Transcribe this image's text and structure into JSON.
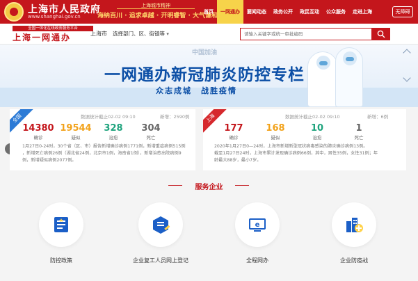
{
  "header": {
    "title": "上海市人民政府",
    "url": "www.shanghai.gov.cn",
    "slogan_top": "上海城市精神",
    "slogan": "海纳百川 · 追求卓越 · 开明睿智 · 大气谦和",
    "nav": [
      "首页",
      "一网通办",
      "要闻动态",
      "政务公开",
      "政民互动",
      "公众服务",
      "走进上海"
    ],
    "barrier_free": "无障碍"
  },
  "subheader": {
    "logo_top": "全国一体化在线政务服务平台",
    "logo": "上海一网通办",
    "city": "上海市",
    "dept": "选择部门、区、街镇等",
    "search_placeholder": "请输入关键字或统一审批编码"
  },
  "banner": {
    "tag": "中国加油",
    "title": "一网通办新冠肺炎防控专栏",
    "subtitle": "众志成城　战胜疫情"
  },
  "national": {
    "ribbon": "全国",
    "time": "数据统计截止02-02 09:10",
    "new": "新增：2590例",
    "stats": [
      {
        "value": "14380",
        "label": "确诊",
        "color": "#c4161c"
      },
      {
        "value": "19544",
        "label": "疑似",
        "color": "#f2a21a"
      },
      {
        "value": "328",
        "label": "治愈",
        "color": "#1ea37d"
      },
      {
        "value": "304",
        "label": "死亡",
        "color": "#666666"
      }
    ],
    "detail": [
      "1月27日0-24时，30个省（区、市）报告新增确诊病例1771例，新增重症病例515例",
      "，新增死亡病例26例（湖北省24例，北京市1例，海南省1例），新增治愈出院病例9",
      "例，新增疑似病例2077例。"
    ]
  },
  "shanghai": {
    "ribbon": "上海",
    "time": "数据统计截止02-02 09:10",
    "new": "新增：6例",
    "stats": [
      {
        "value": "177",
        "label": "确诊",
        "color": "#c4161c"
      },
      {
        "value": "168",
        "label": "疑似",
        "color": "#f2a21a"
      },
      {
        "value": "10",
        "label": "治愈",
        "color": "#1ea37d"
      },
      {
        "value": "1",
        "label": "死亡",
        "color": "#666666"
      }
    ],
    "detail": [
      "2020年1月27日0—24时，上海市新增新型冠状病毒感染的肺炎确诊病例13例。",
      "截至1月27日24时，上海市累计发现确诊病例66例，其中，男性35例，女性31例；年",
      "龄最大88岁，最小7岁。"
    ]
  },
  "services": {
    "title": "服务企业",
    "items": [
      {
        "label": "防控政策",
        "icon": "policy-document-icon"
      },
      {
        "label": "企业复工人员网上登记",
        "icon": "resume-work-register-icon"
      },
      {
        "label": "全程网办",
        "icon": "online-service-icon"
      },
      {
        "label": "企业防疫战",
        "icon": "enterprise-plus-icon"
      }
    ]
  },
  "colors": {
    "brand_red": "#c4161c",
    "accent_yellow": "#f7d34a",
    "banner_blue": "#0c4fa6"
  }
}
